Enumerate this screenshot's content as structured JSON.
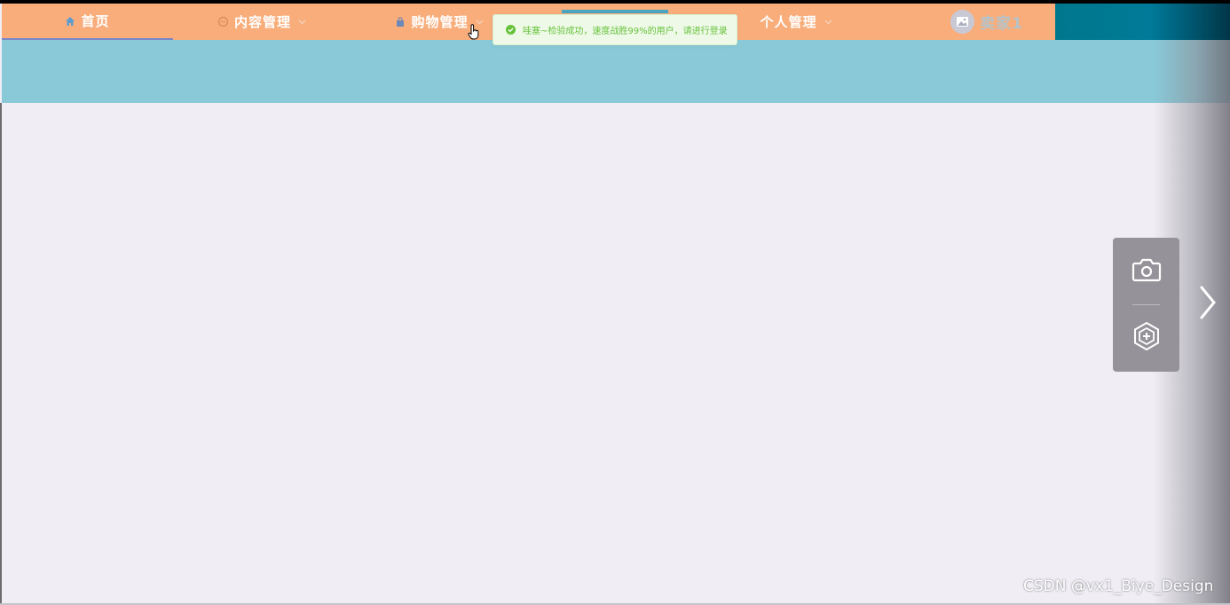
{
  "nav": {
    "home": "首页",
    "content": "内容管理",
    "shop": "购物管理",
    "personal": "个人管理",
    "user": "卖家1"
  },
  "toast": {
    "message": "哇塞~检验成功，速度战胜99%的用户，请进行登录"
  },
  "tools": {
    "camera_icon": "camera-icon",
    "ai_icon": "hexagon-plus-icon",
    "next_icon": "chevron-right-icon"
  },
  "watermark": "CSDN @vx1_Biye_Design",
  "colors": {
    "navbar": "#f8ad7b",
    "banner": "#89c9d8",
    "toast_text": "#67c23a",
    "background": "#f0eef4"
  }
}
